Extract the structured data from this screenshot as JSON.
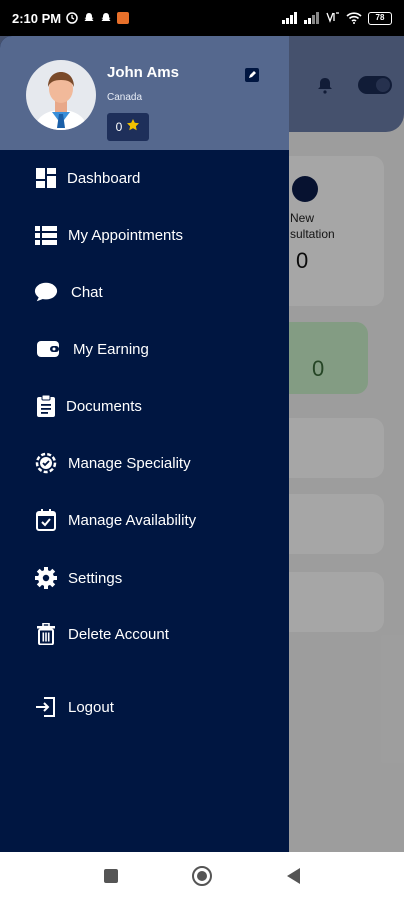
{
  "status_bar": {
    "time": "2:10 PM",
    "battery": "78",
    "icons": [
      "clock-alt-icon",
      "snapchat-icon",
      "snapchat-icon",
      "app-notification-icon",
      "signal-icon",
      "signal-icon",
      "vowifi-icon",
      "wifi-icon",
      "battery-icon"
    ]
  },
  "drawer": {
    "user": {
      "name": "John Ams",
      "country": "Canada",
      "rating": "0"
    },
    "menu": [
      {
        "label": "Dashboard",
        "icon": "dashboard-icon"
      },
      {
        "label": "My Appointments",
        "icon": "list-icon"
      },
      {
        "label": "Chat",
        "icon": "chat-bubble-icon"
      },
      {
        "label": "My Earning",
        "icon": "wallet-icon"
      },
      {
        "label": "Documents",
        "icon": "clipboard-icon"
      },
      {
        "label": "Manage Speciality",
        "icon": "gear-badge-icon"
      },
      {
        "label": "Manage Availability",
        "icon": "calendar-check-icon"
      },
      {
        "label": "Settings",
        "icon": "settings-icon"
      },
      {
        "label": "Delete Account",
        "icon": "trash-icon"
      },
      {
        "label": "Logout",
        "icon": "logout-icon"
      }
    ]
  },
  "background_app": {
    "card_label": "New\nsultation",
    "card_count": "0",
    "green_card_count": "0"
  },
  "colors": {
    "drawer_bg": "#001641",
    "drawer_header_bg": "#55688e",
    "rating_star": "#f2c200"
  }
}
